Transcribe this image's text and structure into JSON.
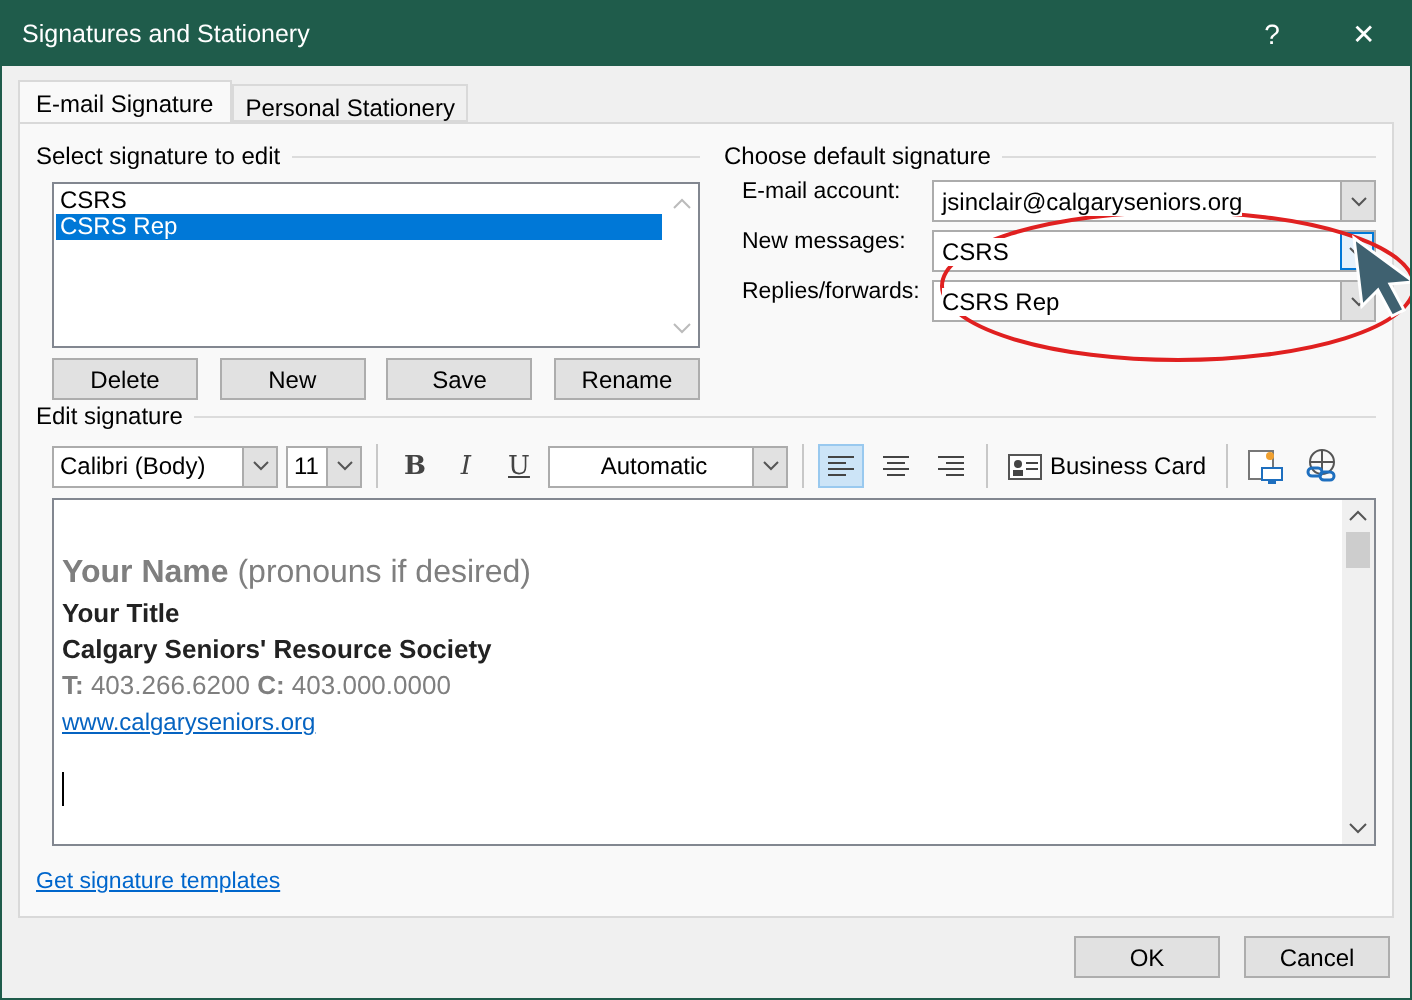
{
  "window": {
    "title": "Signatures and Stationery",
    "help": "?",
    "close": "✕"
  },
  "tabs": [
    {
      "label": "E-mail Signature",
      "selected": true
    },
    {
      "label": "Personal Stationery",
      "selected": false
    }
  ],
  "select_signature": {
    "heading": "Select signature to edit",
    "items": [
      {
        "label": "CSRS",
        "selected": false
      },
      {
        "label": "CSRS Rep",
        "selected": true
      }
    ],
    "buttons": [
      "Delete",
      "New",
      "Save",
      "Rename"
    ]
  },
  "default_signature": {
    "heading": "Choose default signature",
    "fields": [
      {
        "label": "E-mail account:",
        "value": "jsinclair@calgaryseniors.org",
        "focused": false
      },
      {
        "label": "New messages:",
        "value": "CSRS",
        "focused": true
      },
      {
        "label": "Replies/forwards:",
        "value": "CSRS Rep",
        "focused": false
      }
    ]
  },
  "edit_signature": {
    "heading": "Edit signature",
    "font": "Calibri (Body)",
    "size": "11",
    "bold": "B",
    "italic": "I",
    "underline": "U",
    "text_color": "Automatic",
    "alignment": [
      {
        "kind": "left",
        "selected": true
      },
      {
        "kind": "center",
        "selected": false
      },
      {
        "kind": "right",
        "selected": false
      }
    ],
    "business_card": "Business Card",
    "lines": [
      {
        "kind": "name",
        "text": "**Your Name** (pronouns if desired)"
      },
      {
        "kind": "bold",
        "text": "Your Title"
      },
      {
        "kind": "bold",
        "text": "Calgary Seniors' Resource Society"
      },
      {
        "kind": "grey",
        "text": "**T:** 403.266.6200 **C:** 403.000.0000"
      },
      {
        "kind": "link",
        "text": "www.calgaryseniors.org"
      }
    ]
  },
  "templates_link": "Get signature templates",
  "footer_buttons": [
    "OK",
    "Cancel"
  ]
}
